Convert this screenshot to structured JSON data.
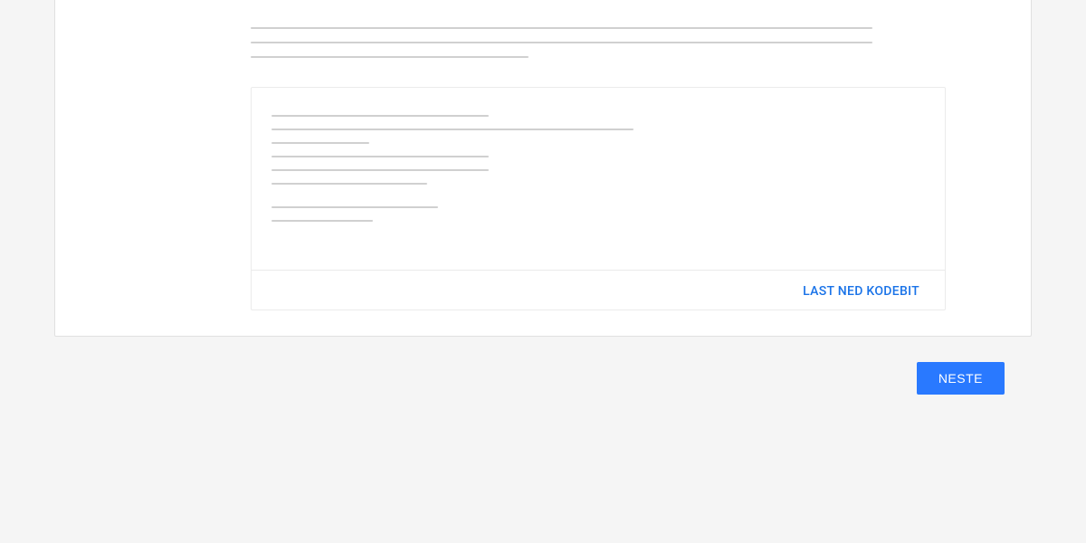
{
  "codeBox": {
    "downloadLabel": "LAST NED KODEBIT"
  },
  "actions": {
    "nextLabel": "NESTE"
  }
}
